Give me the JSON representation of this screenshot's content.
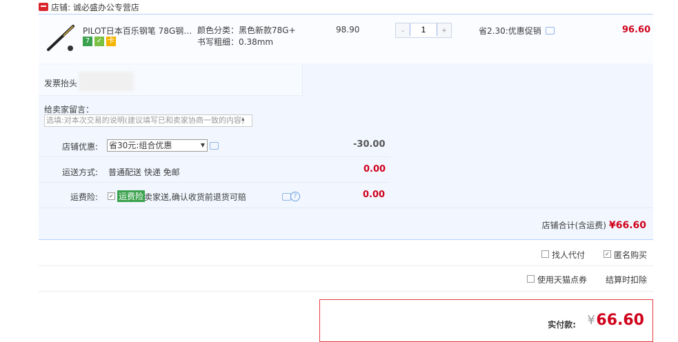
{
  "shop": {
    "label": "店铺: 诚必盛办公专营店"
  },
  "item": {
    "title": "PILOT日本百乐钢笔 78G钢笔...",
    "sku_color": "颜色分类：黑色新款78G+",
    "sku_nib": "书写粗细：0.38mm",
    "price": "98.90",
    "qty": "1",
    "promo": "省2.30:优惠促销",
    "subtotal": "96.60",
    "badges": [
      "7",
      "✓",
      "卡"
    ]
  },
  "invoice": {
    "label": "发票抬头"
  },
  "note": {
    "label": "给卖家留言：",
    "placeholder": "选填:对本次交易的说明(建议填写已和卖家协商一致的内容)"
  },
  "discount": {
    "label": "店铺优惠:",
    "selected": "省30元:组合优惠",
    "amount": "-30.00"
  },
  "shipping": {
    "label": "运送方式:",
    "value": "普通配送 快递 免邮",
    "amount": "0.00"
  },
  "insurance": {
    "label": "运费险:",
    "tag": "运费险",
    "text": "卖家送,确认收货前退货可赔",
    "amount": "0.00"
  },
  "store_total": {
    "label": "店铺合计(含运费)",
    "amount": "¥66.60"
  },
  "options": {
    "pay_for_me": "找人代付",
    "anonymous": "匿名购买",
    "tmall_points": "使用天猫点券",
    "settle_note": "结算时扣除"
  },
  "final": {
    "label": "实付款:",
    "currency": "¥",
    "amount": "66.60"
  },
  "colors": {
    "accent": "#d0021b",
    "border_blue": "#b2d1ff",
    "tag_green": "#3aa14d"
  }
}
